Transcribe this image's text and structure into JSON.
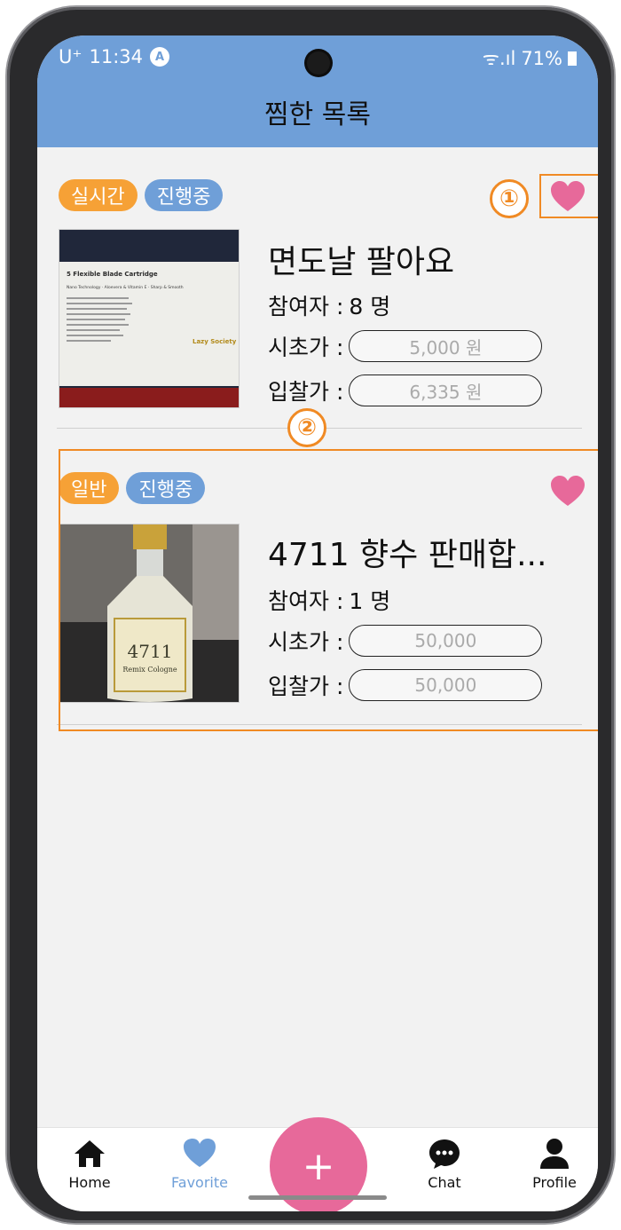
{
  "status_bar": {
    "carrier": "U⁺",
    "time": "11:34",
    "badge": "A",
    "signal": "ᯤ.ıl",
    "battery": "71%"
  },
  "header": {
    "title": "찜한 목록"
  },
  "annotations": {
    "one": "①",
    "two": "②"
  },
  "items": [
    {
      "badge_type": "실시간",
      "badge_status": "진행중",
      "title": "면도날 팔아요",
      "participants_label": "참여자 :",
      "participants_value": "8 명",
      "start_price_label": "시초가 :",
      "start_price_value": "5,000 원",
      "bid_price_label": "입찰가 :",
      "bid_price_value": "6,335 원"
    },
    {
      "badge_type": "일반",
      "badge_status": "진행중",
      "title": "4711 향수 판매합...",
      "participants_label": "참여자 :",
      "participants_value": "1 명",
      "start_price_label": "시초가 :",
      "start_price_value": "50,000",
      "bid_price_label": "입찰가 :",
      "bid_price_value": "50,000"
    }
  ],
  "product_images": {
    "blade_heading": "5 Flexible Blade Cartridge",
    "blade_subheading": "Nano Technology · Aloevera & Vitamin E · Sharp & Smooth",
    "blade_brand": "Lazy Society",
    "perfume_label": "4711",
    "perfume_name": "Remix Cologne"
  },
  "bottom_nav": {
    "home": "Home",
    "favorite": "Favorite",
    "add": "+",
    "chat": "Chat",
    "profile": "Profile"
  },
  "colors": {
    "header": "#6f9fd8",
    "badge_orange": "#f6a136",
    "badge_blue": "#6f9fd8",
    "heart": "#e7699a",
    "annotation": "#f08a24"
  }
}
